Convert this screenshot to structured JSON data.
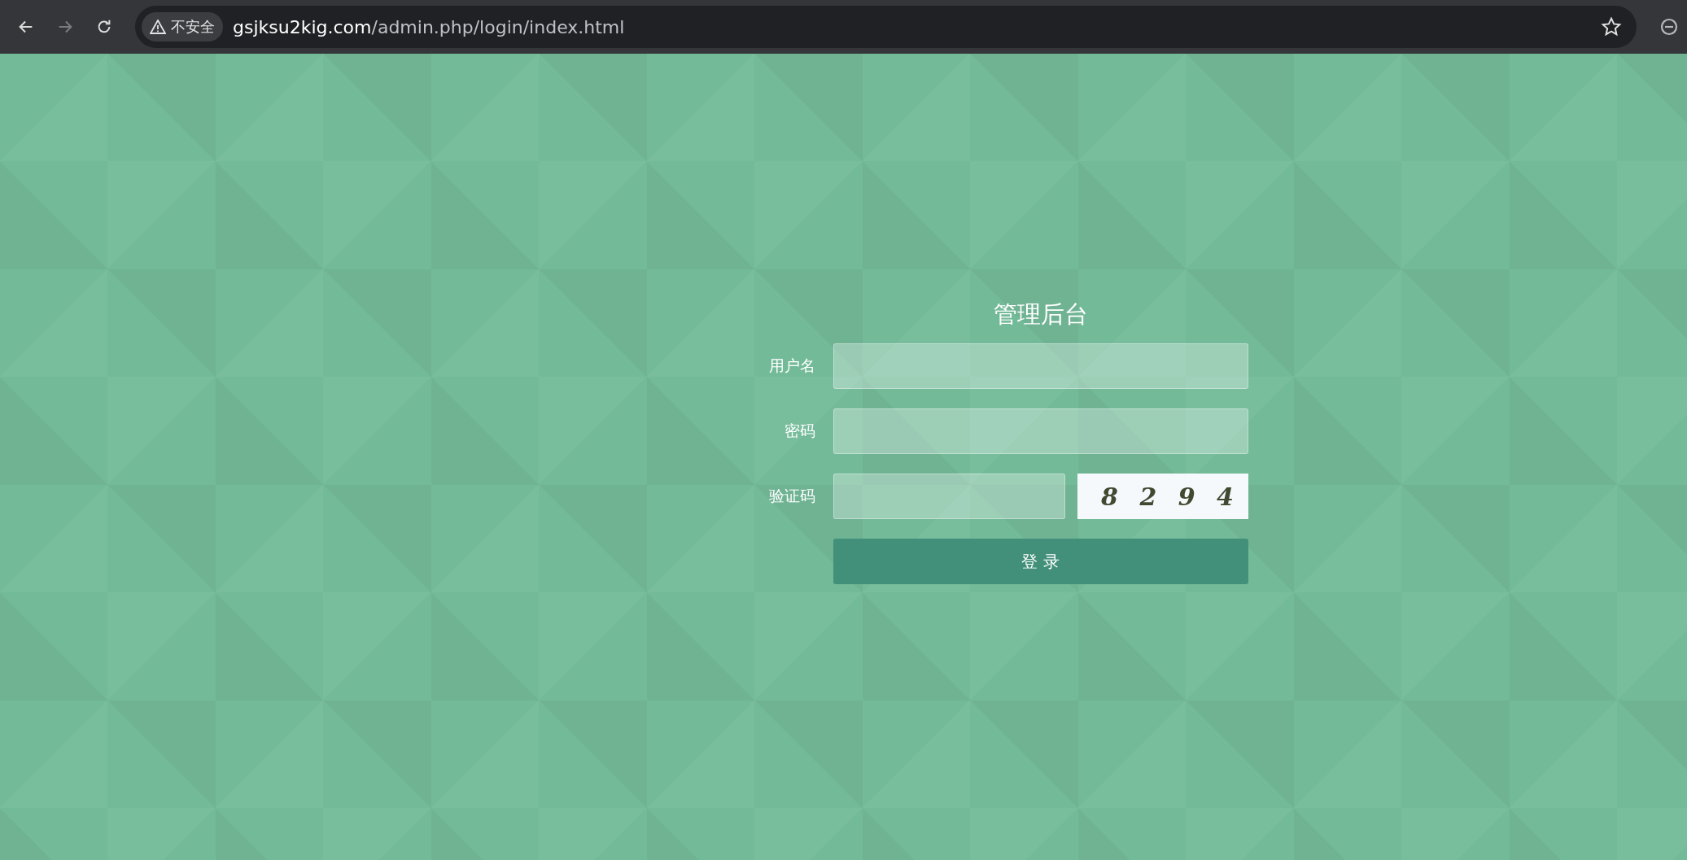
{
  "browser": {
    "nav": [
      {
        "kind": "back",
        "disabled": false
      },
      {
        "kind": "forward",
        "disabled": true
      },
      {
        "kind": "reload",
        "disabled": false
      }
    ],
    "security_badge": "不安全",
    "url": {
      "host": "gsjksu2kig.com",
      "path": "/admin.php/login/index.html"
    }
  },
  "login": {
    "title": "管理后台",
    "fields": [
      {
        "kind": "text",
        "label": "用户名"
      },
      {
        "kind": "password",
        "label": "密码"
      },
      {
        "kind": "captcha",
        "label": "验证码",
        "captcha_code": "8 2 9 4"
      }
    ],
    "submit": "登 录"
  }
}
